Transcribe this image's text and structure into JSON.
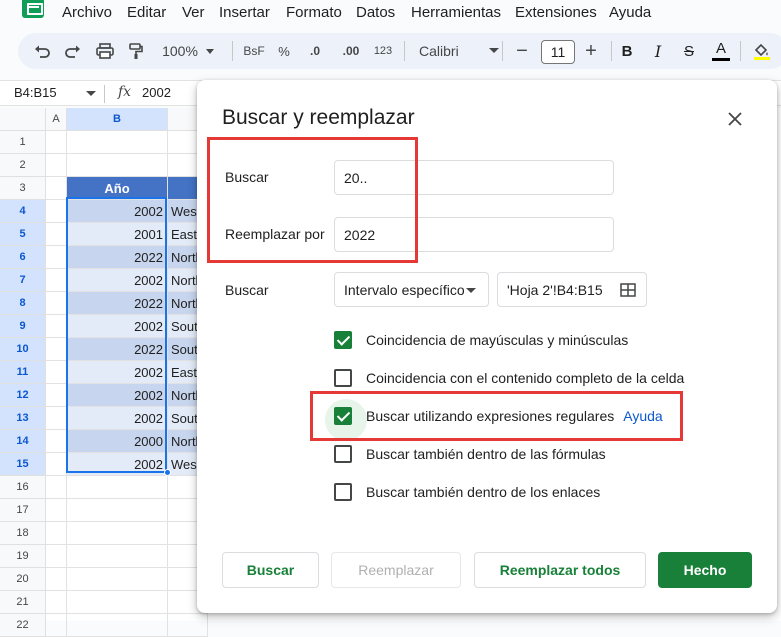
{
  "menu": {
    "items": [
      "Archivo",
      "Editar",
      "Ver",
      "Insertar",
      "Formato",
      "Datos",
      "Herramientas",
      "Extensiones",
      "Ayuda"
    ]
  },
  "toolbar": {
    "zoom": "100%",
    "format_currency": "BsF",
    "format_percent": "%",
    "decimal_decrease": ".0",
    "decimal_increase": ".00",
    "format_number": "123",
    "font_family": "Calibri",
    "font_size": "11",
    "minus": "−",
    "plus": "+",
    "bold": "B",
    "italic": "I",
    "strike": "S",
    "text_color": "A"
  },
  "formula_bar": {
    "name_box": "B4:B15",
    "fx": "fx",
    "value": "2002"
  },
  "grid": {
    "col_headers": [
      "A",
      "B"
    ],
    "header_cell": "Año",
    "row_numbers": [
      "1",
      "2",
      "3",
      "4",
      "5",
      "6",
      "7",
      "8",
      "9",
      "10",
      "11",
      "12",
      "13",
      "14",
      "15",
      "16",
      "17",
      "18",
      "19",
      "20",
      "21",
      "22"
    ],
    "rows": [
      {
        "year": "2002",
        "region": "West"
      },
      {
        "year": "2001",
        "region": "East"
      },
      {
        "year": "2022",
        "region": "North"
      },
      {
        "year": "2002",
        "region": "North"
      },
      {
        "year": "2022",
        "region": "North"
      },
      {
        "year": "2002",
        "region": "South"
      },
      {
        "year": "2022",
        "region": "South"
      },
      {
        "year": "2002",
        "region": "East"
      },
      {
        "year": "2002",
        "region": "North"
      },
      {
        "year": "2002",
        "region": "South"
      },
      {
        "year": "2000",
        "region": "North"
      },
      {
        "year": "2002",
        "region": "West"
      }
    ],
    "colors": {
      "header_fill": "#4472c4",
      "row_dark": "#c7d6ee",
      "row_light": "#e3ebf8"
    }
  },
  "dialog": {
    "title": "Buscar y reemplazar",
    "find_label": "Buscar",
    "find_value": "20..",
    "replace_label": "Reemplazar por",
    "replace_value": "2022",
    "search_label": "Buscar",
    "search_scope": "Intervalo específico",
    "range_value": "'Hoja 2'!B4:B15",
    "options": [
      {
        "label": "Coincidencia de mayúsculas y minúsculas",
        "checked": true
      },
      {
        "label": "Coincidencia con el contenido completo de la celda",
        "checked": false
      },
      {
        "label": "Buscar utilizando expresiones regulares",
        "checked": true,
        "link": "Ayuda"
      },
      {
        "label": "Buscar también dentro de las fórmulas",
        "checked": false
      },
      {
        "label": "Buscar también dentro de los enlaces",
        "checked": false
      }
    ],
    "buttons": {
      "find": "Buscar",
      "replace": "Reemplazar",
      "replace_all": "Reemplazar todos",
      "done": "Hecho"
    }
  },
  "colors": {
    "accent": "#188038",
    "annotation": "#e53935",
    "selection": "#1a73e8"
  }
}
